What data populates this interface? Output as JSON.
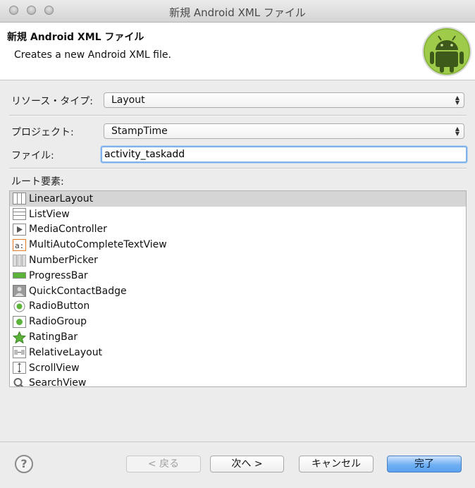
{
  "window": {
    "title": "新規 Android XML ファイル"
  },
  "header": {
    "title": "新規 Android XML ファイル",
    "description": "Creates a new Android XML file."
  },
  "form": {
    "resource_type_label": "リソース・タイプ:",
    "resource_type_value": "Layout",
    "project_label": "プロジェクト:",
    "project_value": "StampTime",
    "file_label": "ファイル:",
    "file_value": "activity_taskadd",
    "root_element_label": "ルート要素:"
  },
  "root_elements": [
    {
      "label": "LinearLayout",
      "icon": "linear-layout-icon",
      "selected": true
    },
    {
      "label": "ListView",
      "icon": "list-view-icon"
    },
    {
      "label": "MediaController",
      "icon": "media-controller-icon"
    },
    {
      "label": "MultiAutoCompleteTextView",
      "icon": "auto-complete-icon"
    },
    {
      "label": "NumberPicker",
      "icon": "number-picker-icon"
    },
    {
      "label": "ProgressBar",
      "icon": "progress-bar-icon"
    },
    {
      "label": "QuickContactBadge",
      "icon": "contact-badge-icon"
    },
    {
      "label": "RadioButton",
      "icon": "radio-button-icon"
    },
    {
      "label": "RadioGroup",
      "icon": "radio-group-icon"
    },
    {
      "label": "RatingBar",
      "icon": "rating-star-icon"
    },
    {
      "label": "RelativeLayout",
      "icon": "relative-layout-icon"
    },
    {
      "label": "ScrollView",
      "icon": "scroll-view-icon"
    },
    {
      "label": "SearchView",
      "icon": "search-icon"
    }
  ],
  "buttons": {
    "help": "?",
    "back": "< 戻る",
    "next": "次へ >",
    "cancel": "キャンセル",
    "finish": "完了"
  },
  "colors": {
    "accent": "#5aa2ef",
    "android_green": "#8cc63f",
    "selection": "#d5d5d5"
  }
}
